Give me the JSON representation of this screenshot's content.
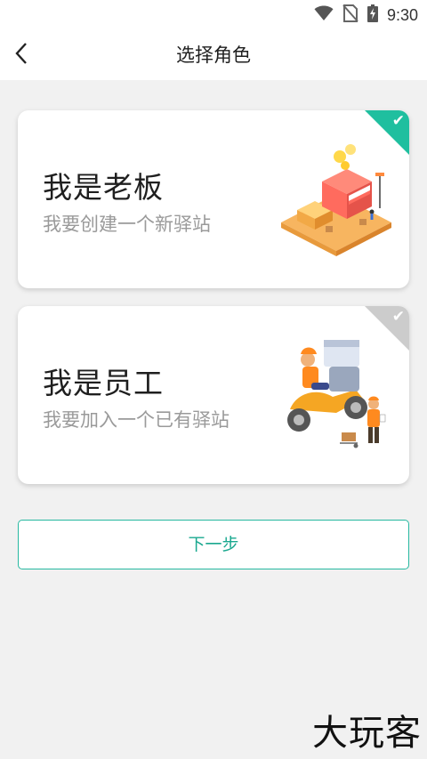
{
  "status_bar": {
    "time": "9:30",
    "icons": [
      "wifi-icon",
      "no-sim-icon",
      "battery-charging-icon"
    ]
  },
  "app_bar": {
    "title": "选择角色",
    "back_icon": "chevron-left-icon"
  },
  "roles": [
    {
      "title": "我是老板",
      "subtitle": "我要创建一个新驿站",
      "selected": true,
      "illustration": "shop-illustration",
      "check_color": "#1fbf9f"
    },
    {
      "title": "我是员工",
      "subtitle": "我要加入一个已有驿站",
      "selected": false,
      "illustration": "courier-illustration",
      "check_color": "#cccccc"
    }
  ],
  "next_button": {
    "label": "下一步",
    "color": "#1aa88f"
  },
  "watermark": "大玩客"
}
